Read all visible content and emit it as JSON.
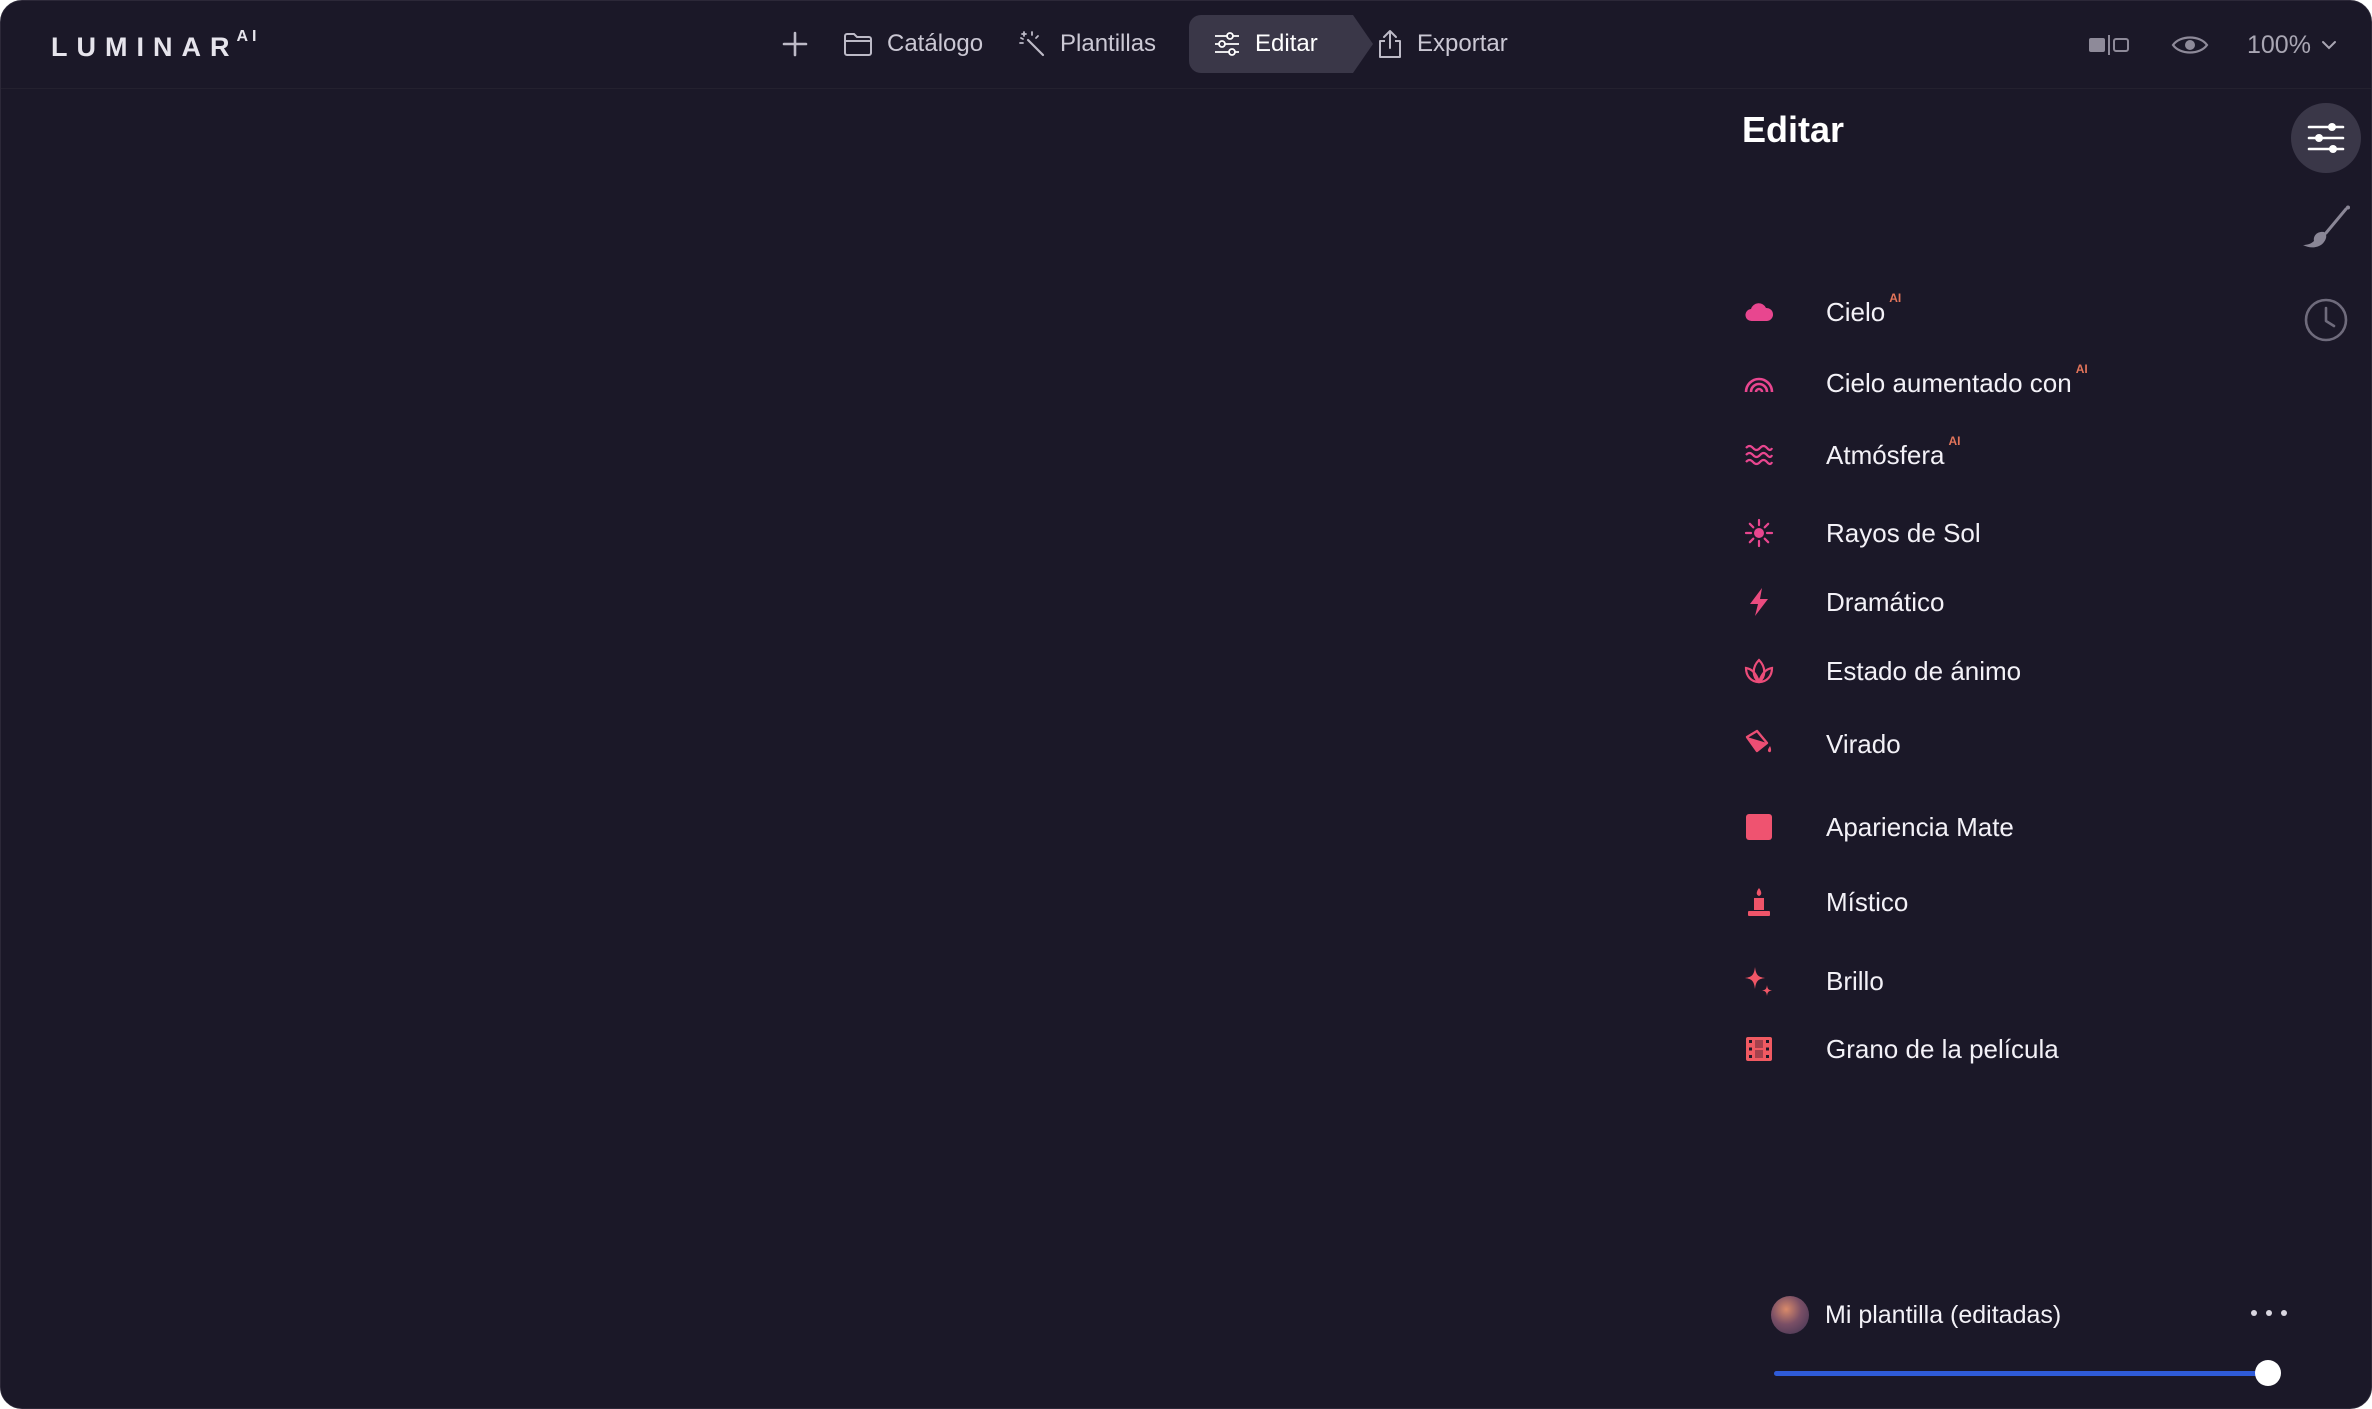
{
  "app": {
    "logo": "LUMINAR",
    "logo_superscript": "AI"
  },
  "nav": {
    "add_icon": "plus-icon",
    "catalog": "Catálogo",
    "templates": "Plantillas",
    "edit": "Editar",
    "export": "Exportar"
  },
  "top_right": {
    "compare_icon": "compare-icon",
    "preview_icon": "eye-icon",
    "zoom": "100%"
  },
  "panel": {
    "title": "Editar",
    "ai_badge": "AI",
    "tools": [
      {
        "label": "Cielo",
        "ai": true,
        "icon": "cloud-icon"
      },
      {
        "label": "Cielo aumentado con",
        "ai": true,
        "icon": "rainbow-icon"
      },
      {
        "label": "Atmósfera",
        "ai": true,
        "icon": "waves-icon"
      },
      {
        "label": "Rayos de Sol",
        "ai": false,
        "icon": "sun-icon"
      },
      {
        "label": "Dramático",
        "ai": false,
        "icon": "lightning-icon"
      },
      {
        "label": "Estado de ánimo",
        "ai": false,
        "icon": "lotus-icon"
      },
      {
        "label": "Virado",
        "ai": false,
        "icon": "paint-bucket-icon"
      },
      {
        "label": "Apariencia Mate",
        "ai": false,
        "icon": "square-icon"
      },
      {
        "label": "Místico",
        "ai": false,
        "icon": "candle-icon"
      },
      {
        "label": "Brillo",
        "ai": false,
        "icon": "sparkle-icon"
      },
      {
        "label": "Grano de la película",
        "ai": false,
        "icon": "film-icon"
      }
    ]
  },
  "strip": {
    "adjust_icon": "sliders-icon",
    "brush_icon": "brush-icon",
    "history_icon": "clock-icon"
  },
  "template": {
    "name": "Mi plantilla (editadas)",
    "amount": 1.0
  },
  "colors": {
    "background": "#1b1828",
    "accent_pink": "#e8468f",
    "accent_coral": "#f0556c",
    "slider_blue": "#2f5bd8",
    "ai_badge": "#e2745a"
  }
}
